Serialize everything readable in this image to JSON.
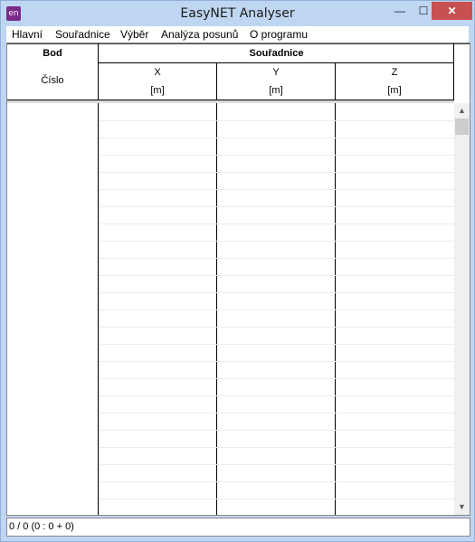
{
  "window": {
    "title": "EasyNET Analyser",
    "icon_text": "en",
    "minimize_glyph": "—",
    "maximize_glyph": "☐",
    "close_glyph": "✕"
  },
  "menu": [
    {
      "label": "Hlavní"
    },
    {
      "label": "Souřadnice"
    },
    {
      "label": "Výběr"
    },
    {
      "label": "Analýza posunů"
    },
    {
      "label": "O programu"
    }
  ],
  "grid": {
    "group_headers": {
      "bod": "Bod",
      "souradnice": "Souřadnice"
    },
    "columns": [
      {
        "name": "Číslo",
        "unit": ""
      },
      {
        "name": "X",
        "unit": "[m]"
      },
      {
        "name": "Y",
        "unit": "[m]"
      },
      {
        "name": "Z",
        "unit": "[m]"
      }
    ],
    "rows": []
  },
  "scrollbar": {
    "up_glyph": "▲",
    "down_glyph": "▼"
  },
  "status": {
    "text": "0 / 0 (0 : 0 + 0)"
  }
}
